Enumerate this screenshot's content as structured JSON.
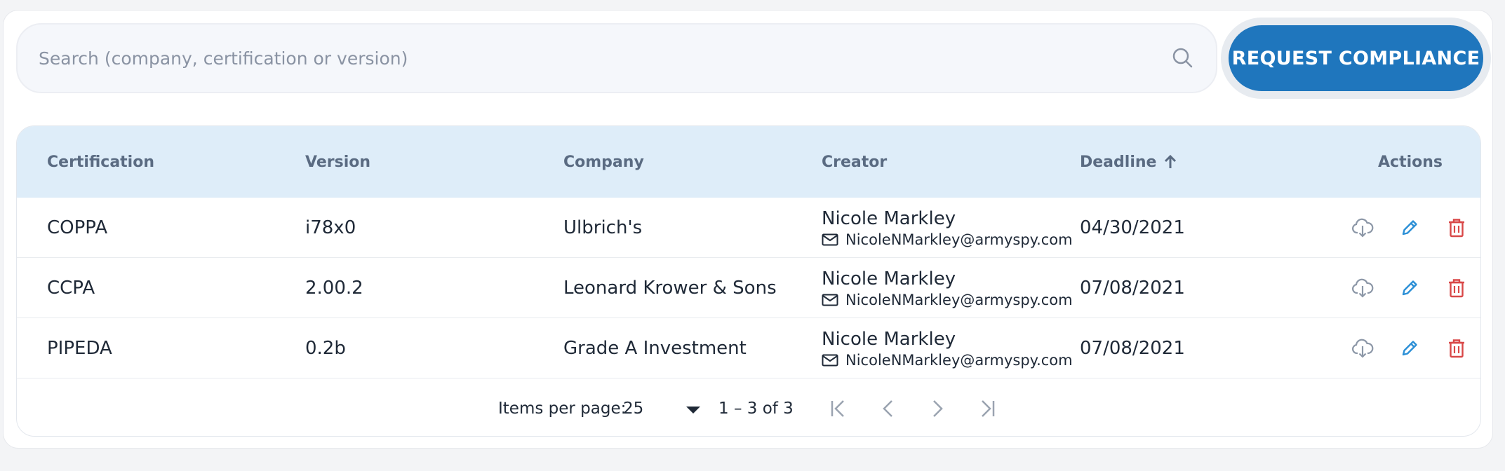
{
  "search": {
    "placeholder": "Search (company, certification or version)"
  },
  "request_button": {
    "label": "REQUEST COMPLIANCE"
  },
  "table": {
    "headers": {
      "certification": "Certification",
      "version": "Version",
      "company": "Company",
      "creator": "Creator",
      "deadline": "Deadline",
      "actions": "Actions"
    },
    "sort": {
      "column": "deadline",
      "direction": "ascending"
    },
    "rows": [
      {
        "certification": "COPPA",
        "version": "i78x0",
        "company": "Ulbrich's",
        "creator_name": "Nicole Markley",
        "creator_email": "NicoleNMarkley@armyspy.com",
        "deadline": "04/30/2021"
      },
      {
        "certification": "CCPA",
        "version": "2.00.2",
        "company": "Leonard Krower & Sons",
        "creator_name": "Nicole Markley",
        "creator_email": "NicoleNMarkley@armyspy.com",
        "deadline": "07/08/2021"
      },
      {
        "certification": "PIPEDA",
        "version": "0.2b",
        "company": "Grade A Investment",
        "creator_name": "Nicole Markley",
        "creator_email": "NicoleNMarkley@armyspy.com",
        "deadline": "07/08/2021"
      }
    ]
  },
  "pagination": {
    "items_per_page_label": "Items per page:",
    "items_per_page_value": "25",
    "range": "1 – 3 of 3"
  },
  "colors": {
    "accent": "#1f76bd",
    "header_bg": "#deedf9",
    "edit_icon": "#2b8fd6",
    "delete_icon": "#d94848",
    "download_icon": "#8c97a7"
  },
  "icons": {
    "search": "search-icon",
    "sort": "arrow-up-icon",
    "mail": "mail-icon",
    "download": "cloud-download-icon",
    "edit": "pencil-icon",
    "delete": "trash-icon",
    "first_page": "first-page-icon",
    "prev_page": "chevron-left-icon",
    "next_page": "chevron-right-icon",
    "last_page": "last-page-icon"
  }
}
